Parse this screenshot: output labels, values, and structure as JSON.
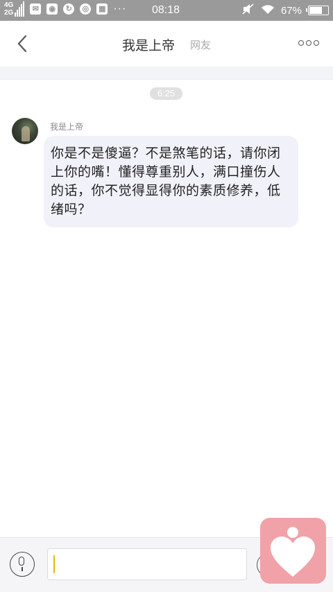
{
  "status_bar": {
    "network": [
      "4G",
      "2G"
    ],
    "more": "···",
    "time": "08:18",
    "battery": "67%"
  },
  "header": {
    "title": "我是上帝",
    "subtitle": "网友"
  },
  "chat": {
    "timestamp": "6:25",
    "messages": [
      {
        "sender": "我是上帝",
        "text": "你是不是傻逼？不是煞笔的话，请你闭上你的嘴！懂得尊重别人，满口撞伤人的话，你不觉得显得你的素质修养，低绪吗？"
      }
    ]
  },
  "input": {
    "value": ""
  },
  "colors": {
    "status_bar_bg": "#9a9a9a",
    "bubble_bg": "#f1f1f9",
    "caret": "#e8b800",
    "fab": "#f0a2a8"
  }
}
